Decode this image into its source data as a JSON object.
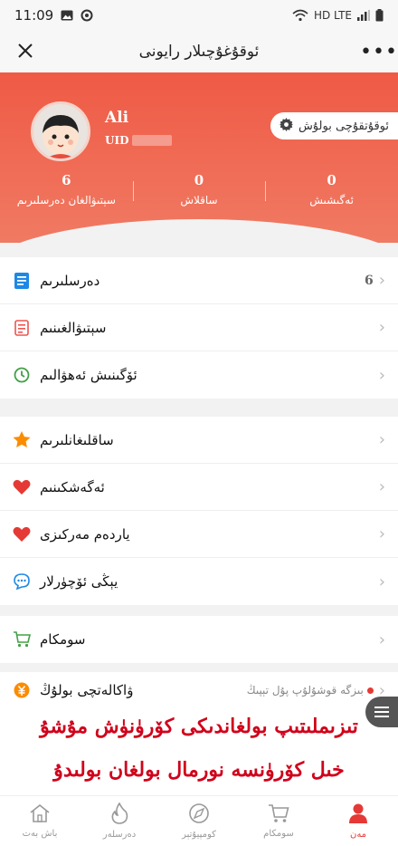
{
  "status_bar": {
    "time": "11:09",
    "network": "HD LTE"
  },
  "title_bar": {
    "title": "ئوقۇغۇچىلار رايونى",
    "more": "•••"
  },
  "profile": {
    "name": "Ali",
    "uid_label": "UID",
    "settings_label": "ئوقۇتقۇچى بولۇش",
    "stats": [
      {
        "value": "6",
        "label": "سېتىۋالغان دەرسلىرىم"
      },
      {
        "value": "0",
        "label": "ساقلاش"
      },
      {
        "value": "0",
        "label": "ئەگىشىش"
      }
    ]
  },
  "menu": {
    "group1": [
      {
        "label": "دەرسلىرىم",
        "count": "6",
        "icon": "book-icon",
        "color": "#1e88e5"
      },
      {
        "label": "سېتىۋالغىنىم",
        "icon": "receipt-icon",
        "color": "#ef5350"
      },
      {
        "label": "ئۆگىنىش ئەھۋالىم",
        "icon": "clock-icon",
        "color": "#43a047"
      }
    ],
    "group2": [
      {
        "label": "ساقلىغانلىرىم",
        "icon": "star-icon",
        "color": "#fb8c00"
      },
      {
        "label": "ئەگەشكىنىم",
        "icon": "heart-icon",
        "color": "#e53935"
      },
      {
        "label": "ياردەم مەركىزى",
        "icon": "heart-icon",
        "color": "#e53935"
      },
      {
        "label": "يېڭى ئۆچۈرلار",
        "icon": "chat-icon",
        "color": "#1e88e5"
      }
    ],
    "group3": [
      {
        "label": "سومكام",
        "icon": "cart-icon",
        "color": "#43a047"
      }
    ],
    "group4": [
      {
        "label": "ۋاكالەتچى بولۇڭ",
        "icon": "money-icon",
        "color": "#fb8c00",
        "note": "بىزگە قوشۇلۇپ پۇل تېپىڭ"
      }
    ]
  },
  "notice": {
    "line1": "تىزىملىتىپ بولغاندىكى كۆرۈنۈش مۇشۇ",
    "line2": "خىل كۆرۈنسە نورمال بولغان بولىدۇ"
  },
  "tabbar": [
    {
      "label": "باش بەت",
      "icon": "home-icon",
      "active": false
    },
    {
      "label": "دەرسلەر",
      "icon": "flame-icon",
      "active": false
    },
    {
      "label": "كومپيۇتېر",
      "icon": "compass-icon",
      "active": false
    },
    {
      "label": "سومكام",
      "icon": "cart-icon",
      "active": false
    },
    {
      "label": "مەن",
      "icon": "person-icon",
      "active": true
    }
  ],
  "colors": {
    "accent": "#ef5a45",
    "notice": "#d0021b"
  }
}
